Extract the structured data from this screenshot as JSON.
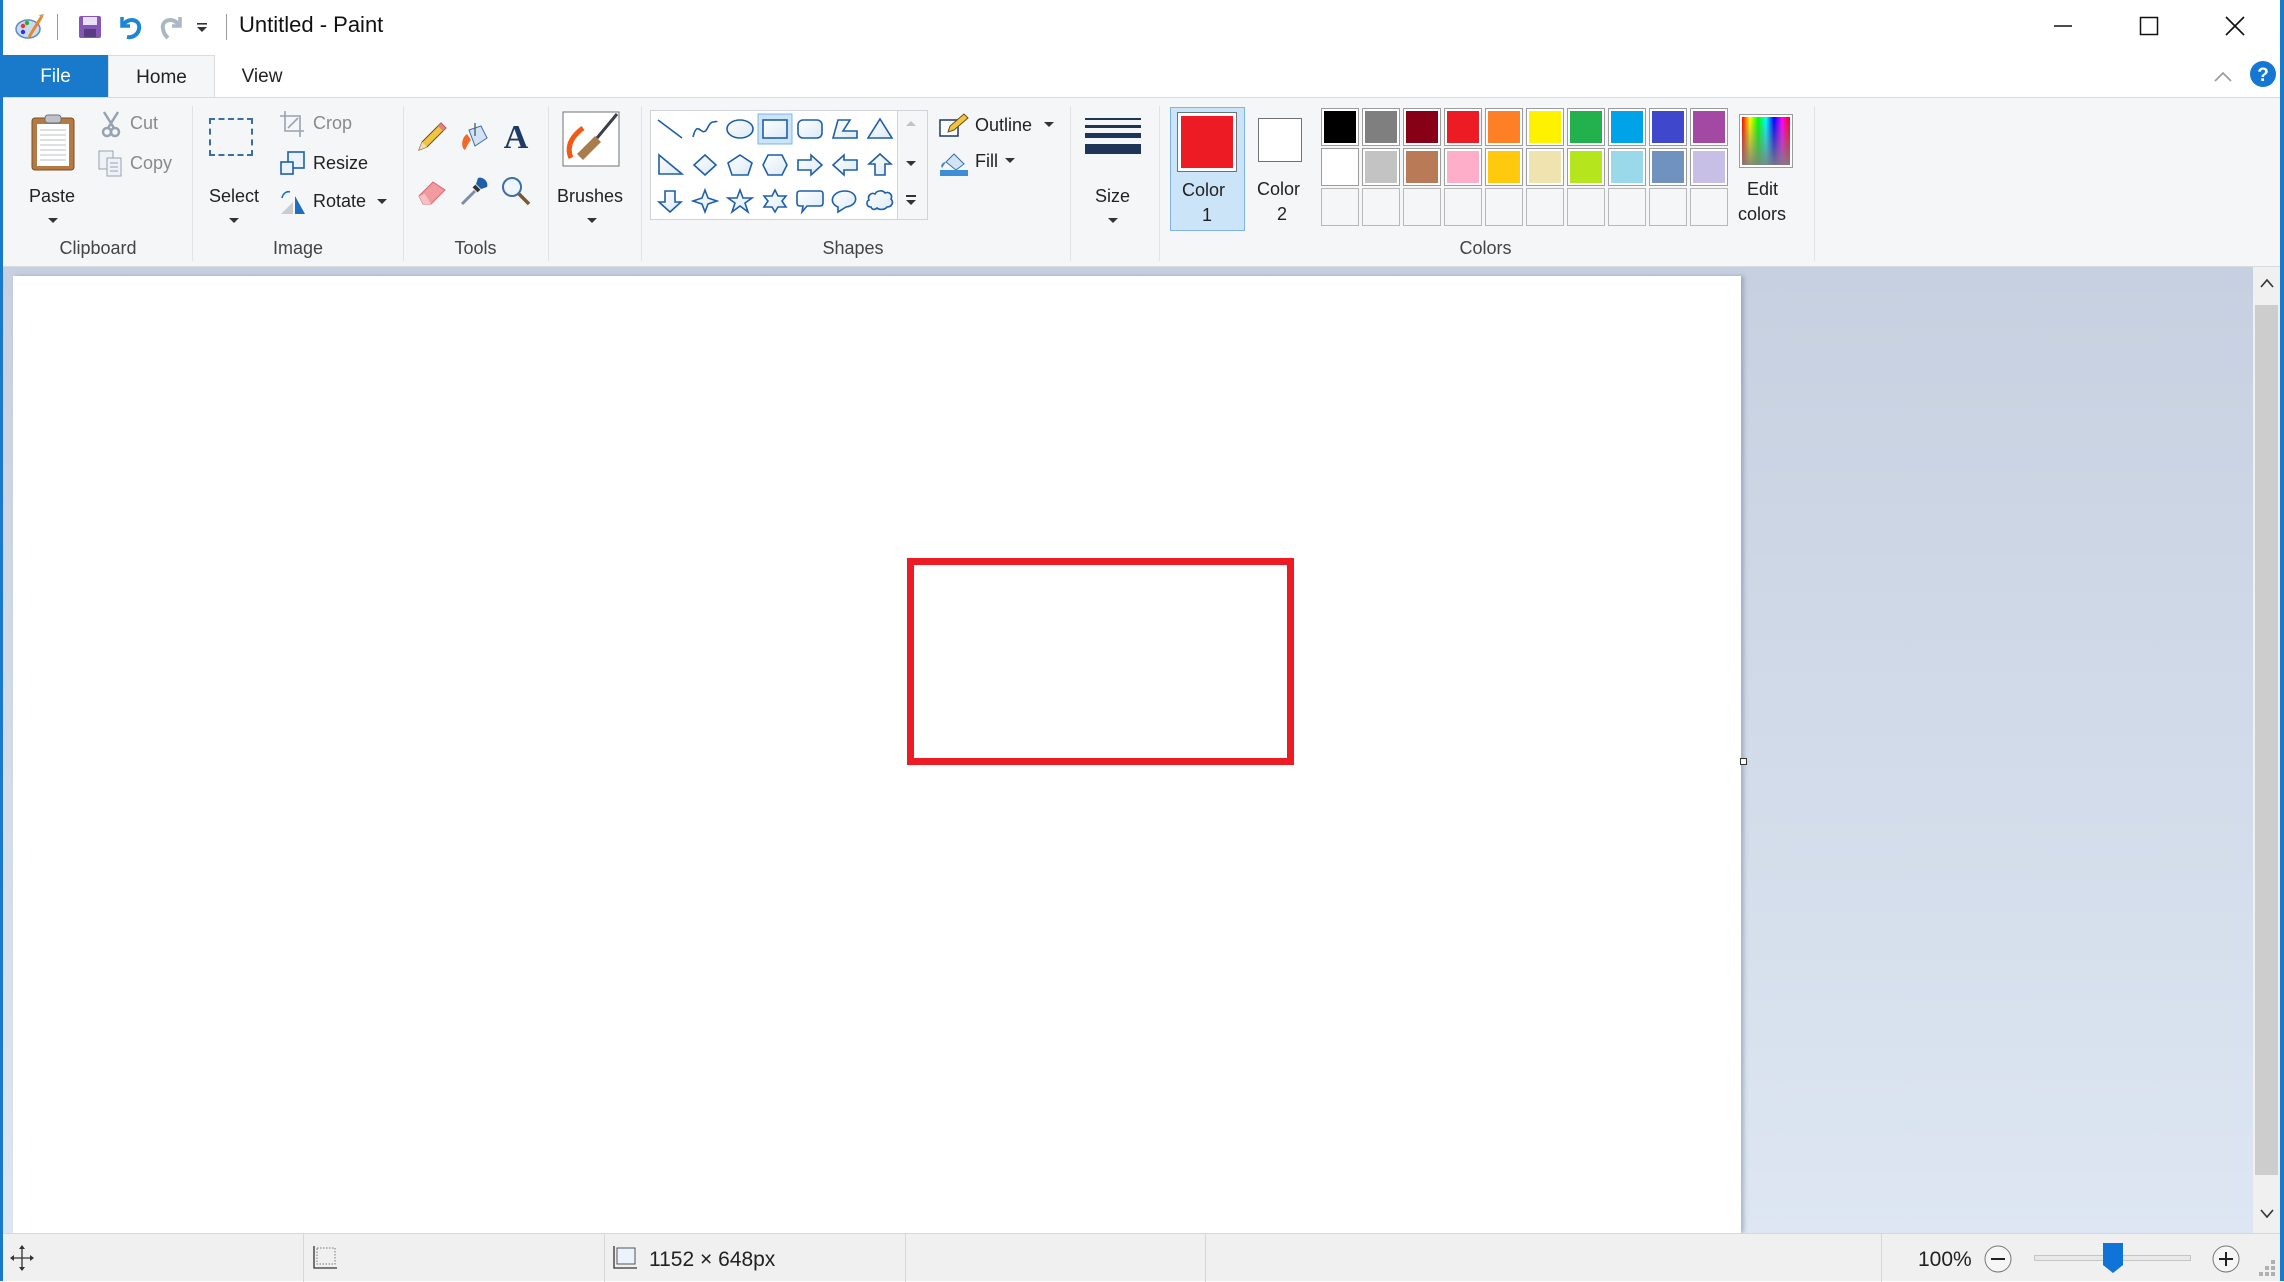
{
  "window": {
    "title": "Untitled - Paint",
    "controls": {
      "minimize": "minimize-icon",
      "maximize": "maximize-icon",
      "close": "close-icon"
    }
  },
  "quick_access": {
    "icons": [
      "paint-app-icon",
      "save-icon",
      "undo-icon",
      "redo-icon",
      "customize-dropdown-icon"
    ]
  },
  "tabs": [
    {
      "label": "File",
      "active": false
    },
    {
      "label": "Home",
      "active": true
    },
    {
      "label": "View",
      "active": false
    }
  ],
  "ribbon": {
    "clipboard": {
      "label": "Clipboard",
      "paste": "Paste",
      "cut": "Cut",
      "copy": "Copy"
    },
    "image": {
      "label": "Image",
      "select": "Select",
      "crop": "Crop",
      "resize": "Resize",
      "rotate": "Rotate"
    },
    "tools": {
      "label": "Tools",
      "items": [
        "pencil-icon",
        "fill-bucket-icon",
        "text-icon",
        "eraser-icon",
        "color-picker-icon",
        "magnifier-icon"
      ]
    },
    "brushes": {
      "label": "Brushes"
    },
    "shapes": {
      "label": "Shapes",
      "outline": "Outline",
      "fill": "Fill",
      "items": [
        "line",
        "curve",
        "oval",
        "rectangle",
        "rounded-rectangle",
        "polygon",
        "triangle",
        "right-triangle",
        "diamond",
        "pentagon",
        "hexagon",
        "right-arrow",
        "left-arrow",
        "up-arrow",
        "down-arrow",
        "four-point-star",
        "five-point-star",
        "six-point-star",
        "rounded-callout",
        "oval-callout",
        "cloud-callout"
      ],
      "selected": "rectangle"
    },
    "size": {
      "label": "Size"
    },
    "colors": {
      "label": "Colors",
      "color1": {
        "label_top": "Color",
        "label_bottom": "1",
        "value": "#ed1c24",
        "active": true
      },
      "color2": {
        "label_top": "Color",
        "label_bottom": "2",
        "value": "#ffffff"
      },
      "palette_row1": [
        "#000000",
        "#7f7f7f",
        "#880015",
        "#ed1c24",
        "#ff7f27",
        "#fff200",
        "#22b14c",
        "#00a2e8",
        "#3f48cc",
        "#a349a4"
      ],
      "palette_row2": [
        "#ffffff",
        "#c3c3c3",
        "#b97a57",
        "#ffaec9",
        "#ffc90e",
        "#efe4b0",
        "#b5e61d",
        "#99d9ea",
        "#7092be",
        "#c8bfe7"
      ],
      "palette_row3_empty": 10,
      "edit_colors_top": "Edit",
      "edit_colors_bottom": "colors"
    }
  },
  "canvas": {
    "drawn_shape": {
      "type": "rectangle",
      "stroke_color": "#ed1c24"
    }
  },
  "statusbar": {
    "canvas_size": "1152 × 648px",
    "zoom": "100%",
    "zoom_level_fraction": 0.5
  }
}
